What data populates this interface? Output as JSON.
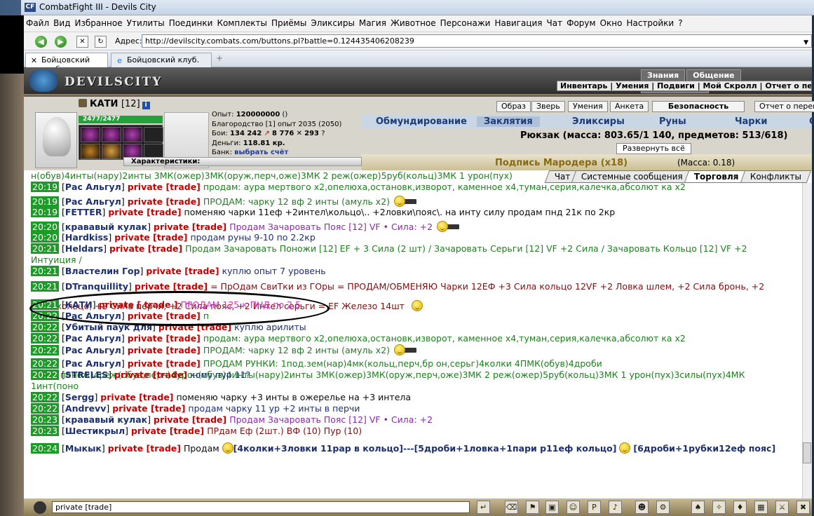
{
  "window": {
    "title": "CombatFight III - Devils City"
  },
  "menu": [
    "Файл",
    "Вид",
    "Избранное",
    "Утилиты",
    "Поединки",
    "Комплекты",
    "Приёмы",
    "Эликсиры",
    "Магия",
    "Животное",
    "Персонажи",
    "Навигация",
    "Чат",
    "Форум",
    "Окно",
    "Настройки",
    "?"
  ],
  "address": {
    "label": "Адрес:",
    "url": "http://devilscity.combats.com/buttons.pl?battle=0.124435406208239"
  },
  "tabs": [
    {
      "label": "Бойцовский клуб"
    },
    {
      "label": "Бойцовский клуб."
    }
  ],
  "game": {
    "logo": "DEVILSCITY",
    "topnav": [
      "Знания",
      "Общение",
      "Безопасност"
    ],
    "subnav": "Инвентарь | Умения | Подвиги | Мой Скролл | Отчет о переводах",
    "char": {
      "name": "КАТИ",
      "level": "[12]",
      "hp": "2477/2477",
      "exp_label": "Опыт:",
      "exp_value": "120000000",
      "exp_extra": "()",
      "honor": "Благородство [1] опыт 2035 (2050)",
      "fights_label": "Бои:",
      "fights_won": "134 242",
      "fights_lost": "8 776",
      "fights_draw": "293",
      "money_label": "Деньги:",
      "money_value": "118.81 кр.",
      "bank_label": "Банк:",
      "bank_value": "выбрать счёт",
      "chars_header": "Характеристики:"
    },
    "buttons": [
      "Образ",
      "Зверь",
      "Умения",
      "Анкета",
      "Безопасность",
      "Отчет о переводах"
    ],
    "invtabs": [
      "Обмундирование",
      "Заклятия",
      "Эликсиры",
      "Руны",
      "Чарки",
      "Стили"
    ],
    "rucksack": "Рюкзак (масса: 803.65/1 140, предметов: 513/618)",
    "expand": "Развернуть всё",
    "inv_item": "Подпись Мародера (x18)",
    "inv_mass": "(Масса: 0.18)"
  },
  "chat": {
    "tabs": [
      "Чат",
      "Системные сообщения",
      "Торговля",
      "Конфликты"
    ],
    "active_tab": "Торговля",
    "pv": "private [trade]",
    "lines": [
      {
        "t": "",
        "n": "",
        "m": "н(обув)4инты(нару)2инты 3МК(ожер)3МК(оруж,перч,оже)3МК 2 реж(ожер)5руб(кольц)3МК 1 урон(пух)",
        "c": "m-g"
      },
      {
        "t": "20:19",
        "n": "Рас Альгул",
        "m": "продам: аура мертвого х2,опелюха,остановк,изворот, каменное х4,туман,серия,калечка,абсолют ка х2",
        "c": "m-g"
      },
      {
        "t": "20:19",
        "n": "Рас Альгул",
        "m": "ПРОДАМ: чарку 12 вф 2 инты (амуль х2)",
        "c": "m-g"
      },
      {
        "t": "20:19",
        "n": "FETTER",
        "m": "поменяю чарки 11еф +2интел\\кольцо\\.. +2ловки\\пояс\\. на инту силу продам пнд 21к по 2кр",
        "c": "m-d"
      },
      {
        "t": "20:20",
        "n": "крававый кулак",
        "m": "Продам Зачаровать Пояс [12] VF • Сила: +2",
        "c": "m-p"
      },
      {
        "t": "20:20",
        "n": "Hardkiss",
        "m": "продам руны 9-10 по 2.2кр",
        "c": "m-b"
      },
      {
        "t": "20:21",
        "n": "Heldars",
        "m": "Продам Зачаровать Поножи [12] EF + 3 Сила (2 шт) / Зачаровать Серьги [12] VF +2 Сила / Зачаровать Кольцо [12] VF +2 Интуиция /",
        "c": "m-g"
      },
      {
        "t": "20:21",
        "n": "Властелин Гор",
        "m": "куплю опыт 7 уровень",
        "c": "m-b"
      },
      {
        "t": "20:21",
        "n": "DTranquillity",
        "m": "= ПрОдам СвиТки из ГОры  = ПРОДАМ/ОБМЕНЯЮ Чарки 12ЕФ +3 Сила кольцо 12VF +2 Ловка шлем, +2 Сила бронь, +2 Сила кольцо, +2 Сила перчи, +2 Сила пояс, +2 Интел серьги = EF Железо 14шт",
        "c": "m-r"
      },
      {
        "t": "20:21",
        "n": "КАТИ",
        "pv": "private [ trade ]",
        "m": "ПРОДАМ 125 к ПНД по 2.5",
        "c": "m-k"
      },
      {
        "t": "20:22",
        "n": "Рас Альгул",
        "m": "п",
        "c": "m-g"
      },
      {
        "t": "20:22",
        "n": "Убитый паук для",
        "m": "куплю арилиты",
        "c": "m-b"
      },
      {
        "t": "20:22",
        "n": "Рас Альгул",
        "m": "продам: аура мертвого х2,опелюха,остановк,изворот, каменное х4,туман,серия,калечка,абсолют ка х2",
        "c": "m-g"
      },
      {
        "t": "20:22",
        "n": "Рас Альгул",
        "m": "ПРОДАМ: чарку 12 вф 2 инты (амуль х2)",
        "c": "m-g"
      },
      {
        "t": "20:22",
        "n": "Рас Альгул",
        "m": "ПРОДАМ РУНКИ: 1под.зем(нар)4мк(кольц,перч,бр он,серьг)4колки 4ПМК(обув)4дроби 1ПМК(понож)4реж(обув,перч)4урон(обув)4инты(нару)2инты 3МК(ожер)3МК(оруж,перч,оже)3МК 2 реж(ожер)5руб(кольц)3МК 1 урон(пух)3силы(пух)4МК 1инт(поно",
        "c": "m-g"
      },
      {
        "t": "20:22",
        "n": "STRELES",
        "m": "кому пур 11?",
        "c": "m-b"
      },
      {
        "t": "20:22",
        "n": "Sergg",
        "m": "поменяю чарку +3 инты в ожерелье на +3 интела",
        "c": "m-d"
      },
      {
        "t": "20:22",
        "n": "Andrevv",
        "m": "продам чарку 11 ур +2 инты в перчи",
        "c": "m-b"
      },
      {
        "t": "20:23",
        "n": "крававый кулак",
        "m": "Продам Зачаровать Пояс [12] VF • Сила: +2",
        "c": "m-p"
      },
      {
        "t": "20:23",
        "n": "Шестикрыл",
        "m": "ПРдам Еф (2шт.) ВФ (10) Пур (10)",
        "c": "m-r"
      },
      {
        "t": "20:24",
        "n": "Мыкык",
        "m": "Продам",
        "m2": "[4колки+3ловки 11рар в кольцо]---[5дроби+1ловка+1пари р11еф кольцо]",
        "m3": "[6дроби+1рубки12еф пояс]",
        "c": "m-d"
      }
    ],
    "input_value": "private [trade]"
  }
}
